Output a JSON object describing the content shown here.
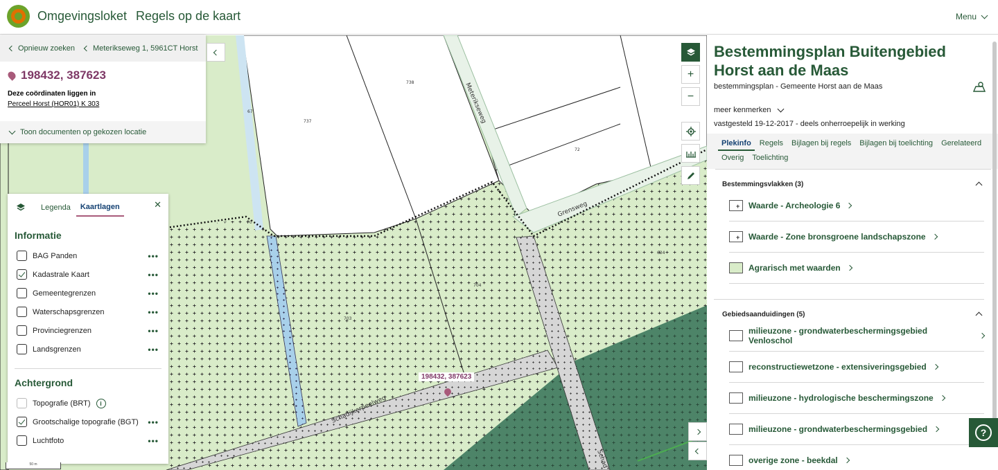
{
  "header": {
    "brand": "Omgevingsloket",
    "title": "Regels op de kaart",
    "menu": "Menu"
  },
  "location": {
    "back_label": "Opnieuw zoeken",
    "address_label": "Meterikseweg 1, 5961CT Horst",
    "coordinates": "198432, 387623",
    "note": "Deze coördinaten liggen in",
    "parcel": "Perceel Horst (HOR01) K 303",
    "show_docs": "Toon documenten op gekozen locatie"
  },
  "map": {
    "pin_label": "198432, 387623",
    "street_labels": [
      "Meterikseweg",
      "Grensweg",
      "Schadijkerpeelweg",
      "Schad"
    ],
    "parcel_numbers": [
      "738",
      "737",
      "72",
      "70",
      "704",
      "703",
      "67",
      "624"
    ],
    "scale_label": "50 m"
  },
  "layers": {
    "tabs": [
      "Legenda",
      "Kaartlagen"
    ],
    "active_tab": "Kaartlagen",
    "sections": [
      {
        "title": "Informatie",
        "items": [
          {
            "label": "BAG Panden",
            "checked": false
          },
          {
            "label": "Kadastrale Kaart",
            "checked": true
          },
          {
            "label": "Gemeentegrenzen",
            "checked": false
          },
          {
            "label": "Waterschapsgrenzen",
            "checked": false
          },
          {
            "label": "Provinciegrenzen",
            "checked": false
          },
          {
            "label": "Landsgrenzen",
            "checked": false
          }
        ]
      },
      {
        "title": "Achtergrond",
        "items": [
          {
            "label": "Topografie (BRT)",
            "checked": false
          },
          {
            "label": "Grootschalige topografie (BGT)",
            "checked": true
          },
          {
            "label": "Luchtfoto",
            "checked": false
          }
        ]
      }
    ]
  },
  "panel": {
    "title": "Bestemmingsplan Buitengebied Horst aan de Maas",
    "subtitle": "bestemmingsplan - Gemeente Horst aan de Maas",
    "more": "meer kenmerken",
    "status": "vastgesteld 19-12-2017 - deels onherroepelijk in werking",
    "tabs": [
      "Plekinfo",
      "Regels",
      "Bijlagen bij regels",
      "Bijlagen bij toelichting",
      "Gerelateerd",
      "Overig",
      "Toelichting"
    ],
    "active_tab": "Plekinfo",
    "groups": [
      {
        "title": "Bestemmingsvlakken (3)",
        "items": [
          {
            "label": "Waarde - Archeologie 6",
            "swatch": "cross"
          },
          {
            "label": "Waarde - Zone bronsgroene landschapszone",
            "swatch": "cross"
          },
          {
            "label": "Agrarisch met waarden",
            "swatch": "agr"
          }
        ]
      },
      {
        "title": "Gebiedsaanduidingen (5)",
        "items": [
          {
            "label": "milieuzone - grondwaterbeschermingsgebied Venloschol",
            "swatch": "plain"
          },
          {
            "label": "reconstructiewetzone - extensiveringsgebied",
            "swatch": "plain"
          },
          {
            "label": "milieuzone - hydrologische beschermingszone",
            "swatch": "plain"
          },
          {
            "label": "milieuzone - grondwaterbeschermingsgebied",
            "swatch": "plain"
          },
          {
            "label": "overige zone - beekdal",
            "swatch": "plain"
          }
        ]
      }
    ]
  },
  "colors": {
    "brand_green": "#275937",
    "accent_purple": "#7e3866",
    "map_light_green": "#d9ecc9",
    "map_dark_green": "#4d8468"
  }
}
